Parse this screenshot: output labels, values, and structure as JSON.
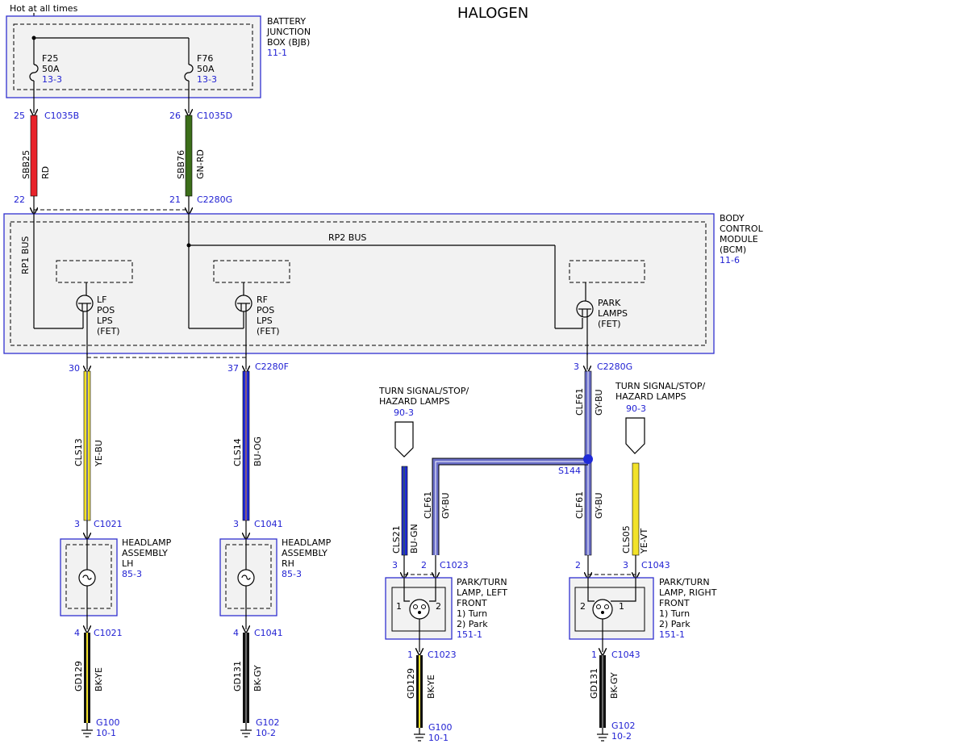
{
  "title": "HALOGEN",
  "hot_label": "Hot at all times",
  "bjb": {
    "l1": "BATTERY",
    "l2": "JUNCTION",
    "l3": "BOX (BJB)",
    "ref": "11-1"
  },
  "bcm": {
    "l1": "BODY",
    "l2": "CONTROL",
    "l3": "MODULE",
    "l4": "(BCM)",
    "ref": "11-6"
  },
  "fuses": [
    {
      "name": "F25",
      "amps": "50A",
      "ref": "13-3"
    },
    {
      "name": "F76",
      "amps": "50A",
      "ref": "13-3"
    }
  ],
  "buses": {
    "rp1": "RP1 BUS",
    "rp2": "RP2 BUS"
  },
  "fets": {
    "lf": [
      "LF",
      "POS",
      "LPS",
      "(FET)"
    ],
    "rf": [
      "RF",
      "POS",
      "LPS",
      "(FET)"
    ],
    "park": [
      "PARK",
      "LAMPS",
      "(FET)"
    ]
  },
  "pins": {
    "p25": "25",
    "c1035b": "C1035B",
    "p26": "26",
    "c1035d": "C1035D",
    "p22": "22",
    "p21": "21",
    "c2280g_top": "C2280G",
    "p30": "30",
    "p37": "37",
    "c2280f": "C2280F",
    "p3_bcm": "3",
    "c2280g_bot": "C2280G",
    "p3_c1021": "3",
    "c1021_top": "C1021",
    "p3_c1041": "3",
    "c1041_top": "C1041",
    "p4_c1021": "4",
    "c1021_bot": "C1021",
    "p4_c1041": "4",
    "c1041_bot": "C1041",
    "p3_c1023": "3",
    "p2_c1023": "2",
    "c1023_top": "C1023",
    "p2_c1043": "2",
    "p3_c1043": "3",
    "c1043_top": "C1043",
    "p1_c1023": "1",
    "c1023_bot": "C1023",
    "p1_c1043": "1",
    "c1043_bot": "C1043"
  },
  "wires": {
    "sbb25": {
      "circuit": "SBB25",
      "color": "RD"
    },
    "sbb76": {
      "circuit": "SBB76",
      "color": "GN-RD"
    },
    "cls13": {
      "circuit": "CLS13",
      "color": "YE-BU"
    },
    "cls14": {
      "circuit": "CLS14",
      "color": "BU-OG"
    },
    "clf61_top": {
      "circuit": "CLF61",
      "color": "GY-BU"
    },
    "clf61_mid": {
      "circuit": "CLF61",
      "color": "GY-BU"
    },
    "clf61_left": {
      "circuit": "CLF61",
      "color": "GY-BU"
    },
    "cls21": {
      "circuit": "CLS21",
      "color": "BU-GN"
    },
    "cls05": {
      "circuit": "CLS05",
      "color": "YE-VT"
    },
    "gd129_a": {
      "circuit": "GD129",
      "color": "BK-YE"
    },
    "gd131_a": {
      "circuit": "GD131",
      "color": "BK-GY"
    },
    "gd129_b": {
      "circuit": "GD129",
      "color": "BK-YE"
    },
    "gd131_b": {
      "circuit": "GD131",
      "color": "BK-GY"
    }
  },
  "splice": "S144",
  "turn_signal": {
    "left": {
      "l1": "TURN SIGNAL/STOP/",
      "l2": "HAZARD LAMPS",
      "ref": "90-3"
    },
    "right": {
      "l1": "TURN SIGNAL/STOP/",
      "l2": "HAZARD LAMPS",
      "ref": "90-3"
    }
  },
  "components": {
    "hl_lh": {
      "l1": "HEADLAMP",
      "l2": "ASSEMBLY",
      "l3": "LH",
      "ref": "85-3"
    },
    "hl_rh": {
      "l1": "HEADLAMP",
      "l2": "ASSEMBLY",
      "l3": "RH",
      "ref": "85-3"
    },
    "pt_lf": {
      "l1": "PARK/TURN",
      "l2": "LAMP, LEFT",
      "l3": "FRONT",
      "l4": "1) Turn",
      "l5": "2) Park",
      "ref": "151-1",
      "pin1": "1",
      "pin2": "2"
    },
    "pt_rf": {
      "l1": "PARK/TURN",
      "l2": "LAMP, RIGHT",
      "l3": "FRONT",
      "l4": "1) Turn",
      "l5": "2) Park",
      "ref": "151-1",
      "pin1": "1",
      "pin2": "2"
    }
  },
  "grounds": {
    "g100_a": {
      "name": "G100",
      "ref": "10-1"
    },
    "g102_a": {
      "name": "G102",
      "ref": "10-2"
    },
    "g100_b": {
      "name": "G100",
      "ref": "10-1"
    },
    "g102_b": {
      "name": "G102",
      "ref": "10-2"
    }
  },
  "wire_colors": {
    "red": "#e8232a",
    "green": "#3c6e1a",
    "yellow": "#f2e22a",
    "blue": "#1f2ad8",
    "grayblue": "#6a6ec8",
    "black": "#111111",
    "accent_blue": "#2f2fd0"
  }
}
